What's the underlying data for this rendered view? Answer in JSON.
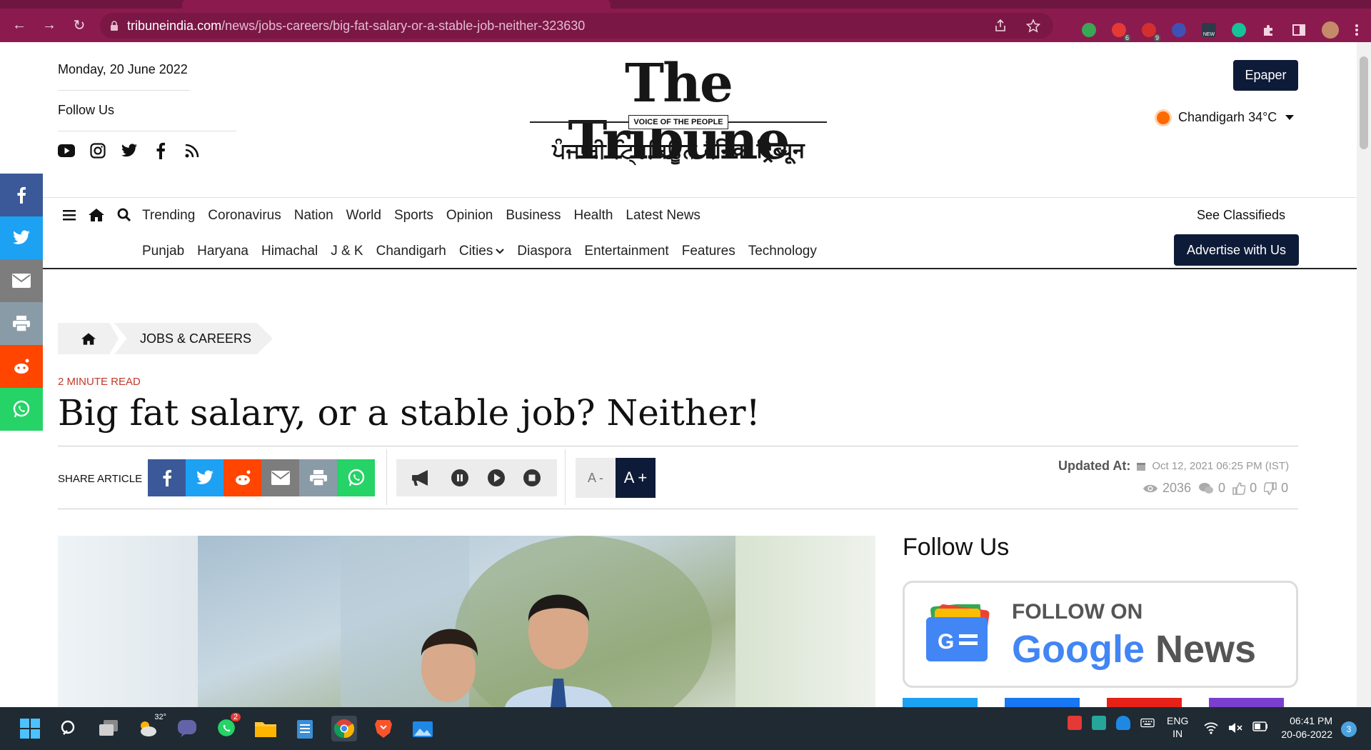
{
  "browser": {
    "url_host": "tribuneindia.com",
    "url_path": "/news/jobs-careers/big-fat-salary-or-a-stable-job-neither-323630",
    "extension_badges": [
      "6",
      "9"
    ],
    "ext_new_label": "NEW"
  },
  "header": {
    "date": "Monday, 20 June 2022",
    "follow_label": "Follow Us",
    "logo_main": "The Tribune",
    "logo_tagline": "VOICE OF THE PEOPLE",
    "logo_sub": "ਪੰਜਾਬੀ ਟ੍ਰਿਬਿਊਨ  दैनिक ट्रिब्यून",
    "epaper": "Epaper",
    "weather": "Chandigarh 34°C"
  },
  "nav": {
    "row1": [
      "Trending",
      "Coronavirus",
      "Nation",
      "World",
      "Sports",
      "Opinion",
      "Business",
      "Health",
      "Latest News"
    ],
    "row2": [
      "Punjab",
      "Haryana",
      "Himachal",
      "J & K",
      "Chandigarh",
      "Cities",
      "Diaspora",
      "Entertainment",
      "Features",
      "Technology"
    ],
    "see_classifieds": "See Classifieds",
    "advertise": "Advertise with Us"
  },
  "breadcrumb": {
    "section": "JOBS & CAREERS"
  },
  "article": {
    "read_time": "2 MINUTE READ",
    "headline": "Big fat salary, or a stable job? Neither!",
    "share_label": "SHARE ARTICLE",
    "font_minus": "A -",
    "font_plus": "A +",
    "updated_label": "Updated At:",
    "updated_time": "Oct 12, 2021 06:25 PM (IST)",
    "views": "2036",
    "comments": "0",
    "likes": "0",
    "dislikes": "0"
  },
  "sidebar": {
    "follow_title": "Follow Us",
    "follow_on": "FOLLOW ON",
    "google": "Google",
    "news": "News"
  },
  "taskbar": {
    "weather_temp": "32°",
    "whatsapp_badge": "2",
    "lang1": "ENG",
    "lang2": "IN",
    "time": "06:41 PM",
    "date": "20-06-2022",
    "notifications": "3"
  },
  "colors": {
    "chrome": "#8b1b4e",
    "navy": "#0e1b38",
    "facebook": "#3b5998",
    "twitter": "#1da1f2",
    "reddit": "#ff4500",
    "whatsapp": "#25d366",
    "email": "#7d7d7d",
    "print": "#8a9ba8"
  }
}
